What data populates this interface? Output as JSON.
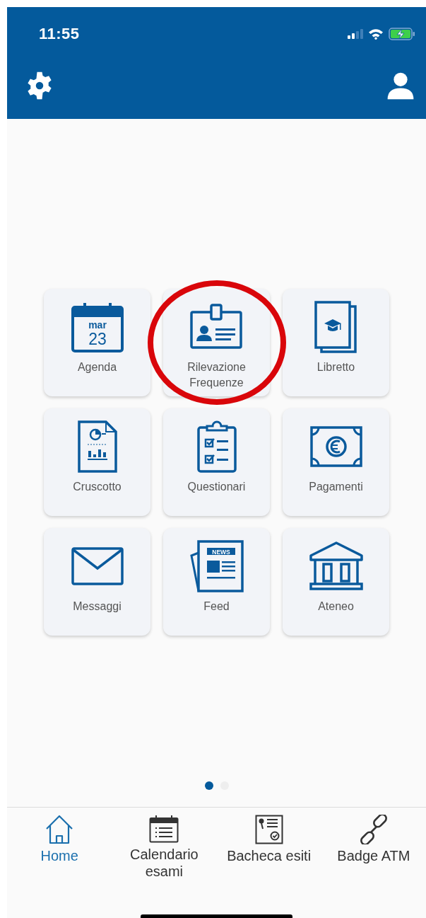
{
  "status_bar": {
    "time": "11:55"
  },
  "tiles": [
    {
      "label": "Agenda",
      "kind": "calendar",
      "icon_texts": [
        "mar",
        "23"
      ],
      "highlighted": false
    },
    {
      "label": "Rilevazione Frequenze",
      "kind": "badge",
      "highlighted": true
    },
    {
      "label": "Libretto",
      "kind": "book",
      "highlighted": false
    },
    {
      "label": "Cruscotto",
      "kind": "report",
      "highlighted": false
    },
    {
      "label": "Questionari",
      "kind": "clipboard",
      "highlighted": false
    },
    {
      "label": "Pagamenti",
      "kind": "money",
      "highlighted": false
    },
    {
      "label": "Messaggi",
      "kind": "mail",
      "highlighted": false
    },
    {
      "label": "Feed",
      "kind": "news",
      "icon_texts": [
        "NEWS"
      ],
      "highlighted": false
    },
    {
      "label": "Ateneo",
      "kind": "building",
      "highlighted": false
    }
  ],
  "pages": [
    {
      "selected": true
    },
    {
      "selected": false
    }
  ],
  "tab_bar": [
    {
      "label": "Home",
      "kind": "home",
      "selected": true
    },
    {
      "label": "Calendario esami",
      "kind": "calendar",
      "selected": false
    },
    {
      "label": "Bacheca esiti",
      "kind": "board",
      "selected": false
    },
    {
      "label": "Badge ATM",
      "kind": "link",
      "selected": false
    }
  ]
}
